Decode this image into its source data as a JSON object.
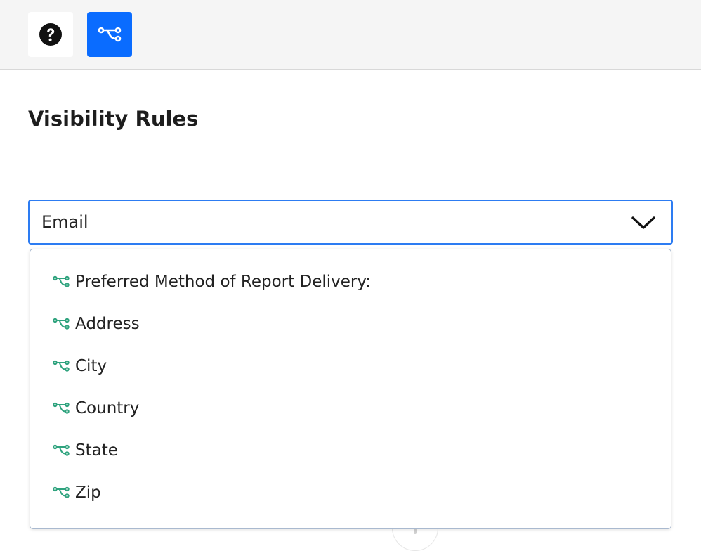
{
  "toolbar": {
    "help_icon": "question-circle-icon",
    "rules_icon": "branch-icon",
    "rules_bg": "#0a6cff"
  },
  "page": {
    "title": "Visibility Rules"
  },
  "select": {
    "value": "Email",
    "border_color": "#2d7cf2"
  },
  "dropdown": {
    "options": [
      {
        "label": "Preferred Method of Report Delivery:",
        "icon": "branch-icon"
      },
      {
        "label": "Address",
        "icon": "branch-icon"
      },
      {
        "label": "City",
        "icon": "branch-icon"
      },
      {
        "label": "Country",
        "icon": "branch-icon"
      },
      {
        "label": "State",
        "icon": "branch-icon"
      },
      {
        "label": "Zip",
        "icon": "branch-icon"
      }
    ],
    "icon_color": "#2fa37e"
  }
}
